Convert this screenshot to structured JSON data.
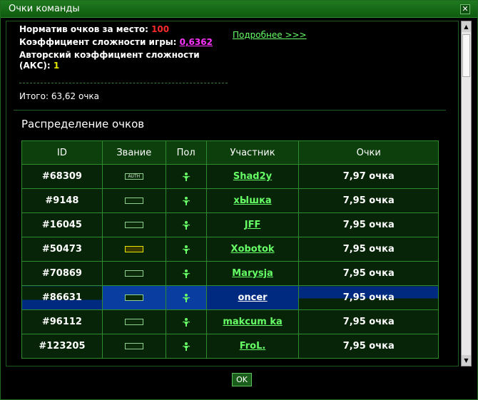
{
  "window": {
    "title": "Очки команды",
    "close_glyph": "✕"
  },
  "info": {
    "norm_label": "Норматив очков за место:",
    "norm_value": "100",
    "coef_label": "Коэффициент сложности игры:",
    "coef_value": "0,6362",
    "akc_label": "Авторский коэффициент сложности (АКС):",
    "akc_value": "1",
    "total": "Итого: 63,62 очка"
  },
  "more_link": "Подробнее >>>",
  "section_title": "Распределение очков",
  "table": {
    "headers": [
      "ID",
      "Звание",
      "Пол",
      "Участник",
      "Очки"
    ],
    "rows": [
      {
        "id": "#68309",
        "rank": "AUTH",
        "rank_style": "plain",
        "player": "Shad2y",
        "points": "7,97 очка",
        "highlight": false
      },
      {
        "id": "#9148",
        "rank": " ",
        "rank_style": "plain",
        "player": "xЫшка",
        "points": "7,95 очка",
        "highlight": false
      },
      {
        "id": "#16045",
        "rank": " ",
        "rank_style": "plain",
        "player": "JFF",
        "points": "7,95 очка",
        "highlight": false
      },
      {
        "id": "#50473",
        "rank": " ",
        "rank_style": "gold",
        "player": "Xobotok",
        "points": "7,95 очка",
        "highlight": false
      },
      {
        "id": "#70869",
        "rank": " ",
        "rank_style": "plain",
        "player": "Marysja",
        "points": "7,95 очка",
        "highlight": false
      },
      {
        "id": "#86631",
        "rank": " ",
        "rank_style": "plain",
        "player": "oncer",
        "points": "7,95 очка",
        "highlight": true
      },
      {
        "id": "#96112",
        "rank": " ",
        "rank_style": "plain",
        "player": "makcum ka",
        "points": "7,95 очка",
        "highlight": false
      },
      {
        "id": "#123205",
        "rank": " ",
        "rank_style": "plain",
        "player": "FroL.",
        "points": "7,95 очка",
        "highlight": false
      }
    ]
  },
  "ok_label": "OK",
  "icons": {
    "sex": "male-icon",
    "close": "close-icon"
  },
  "colors": {
    "accent": "#66ff66",
    "norm": "#ff2a2a",
    "coef": "#ff33ff",
    "akc": "#e6e600",
    "highlight": "#002a80"
  }
}
